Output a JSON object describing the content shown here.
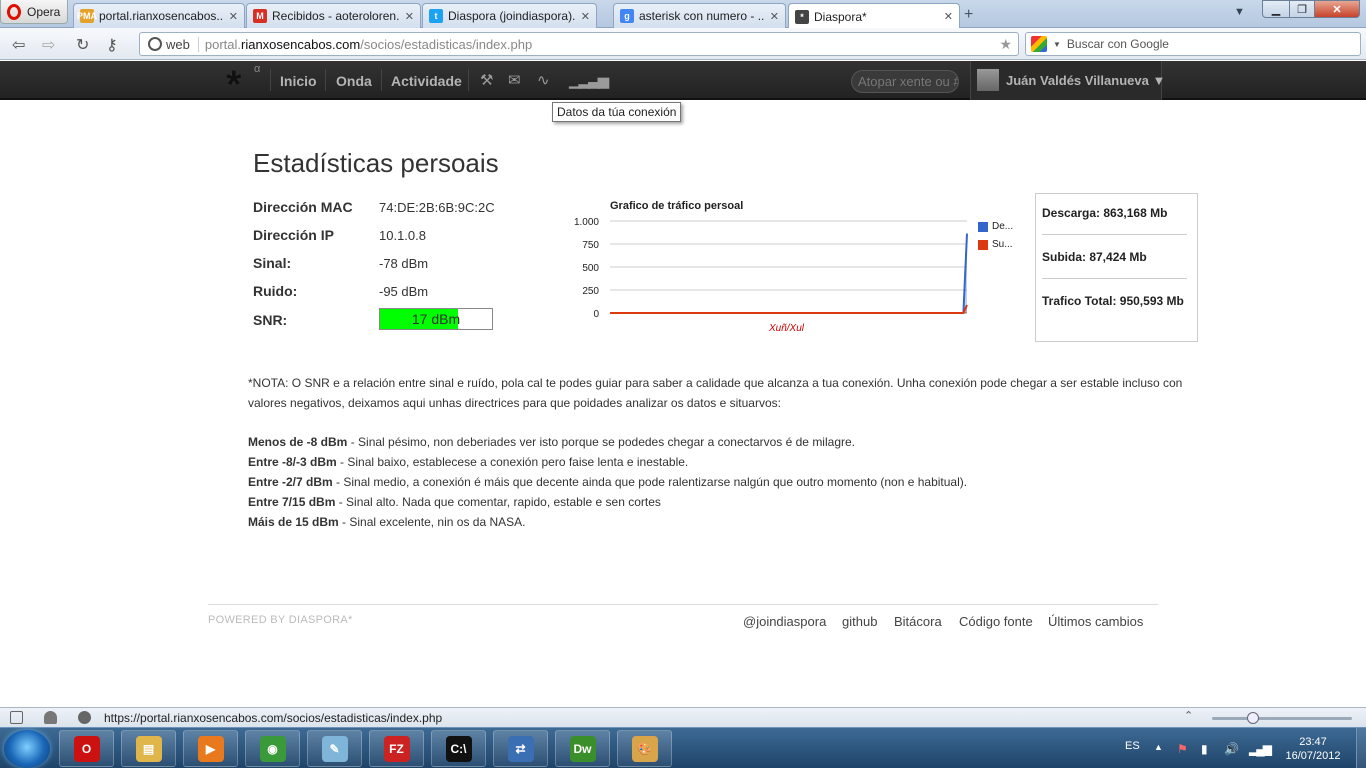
{
  "browser": {
    "opera_label": "Opera",
    "tabs": [
      {
        "title": "portal.rianxosencabos....",
        "favicon": "PMA",
        "favicon_color": "#e3a32b",
        "active": false
      },
      {
        "title": "Recibidos - aoteroloren...",
        "favicon": "M",
        "favicon_color": "#d93025",
        "active": false
      },
      {
        "title": "Diaspora (joindiaspora)...",
        "favicon": "t",
        "favicon_color": "#1da1f2",
        "active": false
      },
      {
        "title": "asterisk con numero - ...",
        "favicon": "g",
        "favicon_color": "#4285f4",
        "active": false
      },
      {
        "title": "Diaspora*",
        "favicon": "*",
        "favicon_color": "#444444",
        "active": true
      }
    ],
    "address": {
      "web_label": "web",
      "url_prefix": "portal.",
      "url_domain": "rianxosencabos.com",
      "url_path": "/socios/estadisticas/index.php"
    },
    "search_placeholder": "Buscar con Google",
    "status_url": "https://portal.rianxosencabos.com/socios/estadisticas/index.php"
  },
  "header": {
    "nav": [
      "Inicio",
      "Onda",
      "Actividade"
    ],
    "search_placeholder": "Atopar xente ou #",
    "user_name": "Juán Valdés Villanueva ▼",
    "tooltip": "Datos da túa conexión"
  },
  "stats": {
    "title": "Estadísticas persoais",
    "rows": [
      {
        "label": "Dirección MAC",
        "value": "74:DE:2B:6B:9C:2C"
      },
      {
        "label": "Dirección IP",
        "value": "10.1.0.8"
      },
      {
        "label": "Sinal:",
        "value": "-78 dBm"
      },
      {
        "label": "Ruido:",
        "value": "-95 dBm"
      }
    ],
    "snr_label": "SNR:",
    "snr_value": "17 dBm",
    "snr_fill_fraction": 0.7,
    "snr_color": "#00ff00"
  },
  "chart_data": {
    "type": "area",
    "title": "Grafico de tráfico persoal",
    "xlabel": "Xuñ/Xul",
    "ylabel": "",
    "ylim": [
      0,
      1000
    ],
    "yticks": [
      "1.000",
      "750",
      "500",
      "250",
      "0"
    ],
    "series": [
      {
        "name": "De...",
        "color": "#3366cc",
        "values": [
          0,
          0,
          0,
          0,
          0,
          0,
          0,
          0,
          0,
          0,
          0,
          0,
          0,
          0,
          0,
          0,
          0,
          0,
          0,
          0,
          0,
          0,
          0,
          0,
          0,
          0,
          0,
          0,
          0,
          0,
          0,
          0,
          0,
          0,
          0,
          0,
          0,
          0,
          0,
          0,
          0,
          0,
          0,
          0,
          0,
          0,
          0,
          0,
          0,
          0,
          0,
          0,
          0,
          0,
          0,
          0,
          0,
          0,
          0,
          0,
          0,
          0,
          0,
          0,
          0,
          0,
          0,
          0,
          0,
          0,
          0,
          0,
          0,
          0,
          0,
          0,
          0,
          0,
          0,
          0,
          0,
          0,
          0,
          0,
          0,
          0,
          0,
          0,
          0,
          0,
          0,
          0,
          0,
          0,
          0,
          0,
          0,
          0,
          0,
          863
        ]
      },
      {
        "name": "Su...",
        "color": "#dc3912",
        "values": [
          0,
          0,
          0,
          0,
          0,
          0,
          0,
          0,
          0,
          0,
          0,
          0,
          0,
          0,
          0,
          0,
          0,
          0,
          0,
          0,
          0,
          0,
          0,
          0,
          0,
          0,
          0,
          0,
          0,
          0,
          0,
          0,
          0,
          0,
          0,
          0,
          0,
          0,
          0,
          0,
          0,
          0,
          0,
          0,
          0,
          0,
          0,
          0,
          0,
          0,
          0,
          0,
          0,
          0,
          0,
          0,
          0,
          0,
          0,
          0,
          0,
          0,
          0,
          0,
          0,
          0,
          0,
          0,
          0,
          0,
          0,
          0,
          0,
          0,
          0,
          0,
          0,
          0,
          0,
          0,
          0,
          0,
          0,
          0,
          0,
          0,
          0,
          0,
          0,
          0,
          0,
          0,
          0,
          0,
          0,
          0,
          0,
          0,
          0,
          87
        ]
      }
    ]
  },
  "totals": {
    "download": "Descarga: 863,168 Mb",
    "upload": "Subida: 87,424 Mb",
    "total": "Trafico Total: 950,593 Mb"
  },
  "note": {
    "text": "*NOTA: O SNR e a relación entre sinal e ruído, pola cal te podes guiar para saber a calidade que alcanza a tua conexión. Unha conexión pode chegar a ser estable incluso con valores negativos, deixamos aqui unhas directrices para que poidades analizar os datos e situarvos:",
    "ranges": [
      {
        "range": "Menos de -8 dBm",
        "desc": " - Sinal pésimo, non deberiades ver isto porque se podedes chegar a conectarvos é de milagre."
      },
      {
        "range": "Entre -8/-3 dBm",
        "desc": " - Sinal baixo, establecese a conexión pero faise lenta e inestable."
      },
      {
        "range": "Entre -2/7 dBm",
        "desc": " - Sinal medio, a conexión é máis que decente ainda que pode ralentizarse nalgún que outro momento (non e habitual)."
      },
      {
        "range": "Entre 7/15 dBm",
        "desc": " - Sinal alto. Nada que comentar, rapido, estable e sen cortes"
      },
      {
        "range": "Máis de 15 dBm",
        "desc": " - Sinal excelente, nin os da NASA."
      }
    ]
  },
  "footer": {
    "powered": "POWERED BY DIASPORA*",
    "links": [
      "@joindiaspora",
      "github",
      "Bitácora",
      "Código fonte",
      "Últimos cambios"
    ]
  },
  "taskbar": {
    "lang": "ES",
    "time": "23:47",
    "date": "16/07/2012",
    "apps": [
      {
        "name": "opera",
        "label": "O",
        "color": "#cc1111"
      },
      {
        "name": "explorer",
        "label": "▤",
        "color": "#e0b64a"
      },
      {
        "name": "media-player",
        "label": "▶",
        "color": "#e87a1d"
      },
      {
        "name": "chrome",
        "label": "◉",
        "color": "#3a9a3a"
      },
      {
        "name": "notepad",
        "label": "✎",
        "color": "#7fb5d9"
      },
      {
        "name": "filezilla",
        "label": "FZ",
        "color": "#c22"
      },
      {
        "name": "cmd",
        "label": "C:\\",
        "color": "#111"
      },
      {
        "name": "network",
        "label": "⇄",
        "color": "#3b6fb3"
      },
      {
        "name": "dreamweaver",
        "label": "Dw",
        "color": "#3a8f2a"
      },
      {
        "name": "paint",
        "label": "🎨",
        "color": "#d9a54a"
      }
    ]
  }
}
